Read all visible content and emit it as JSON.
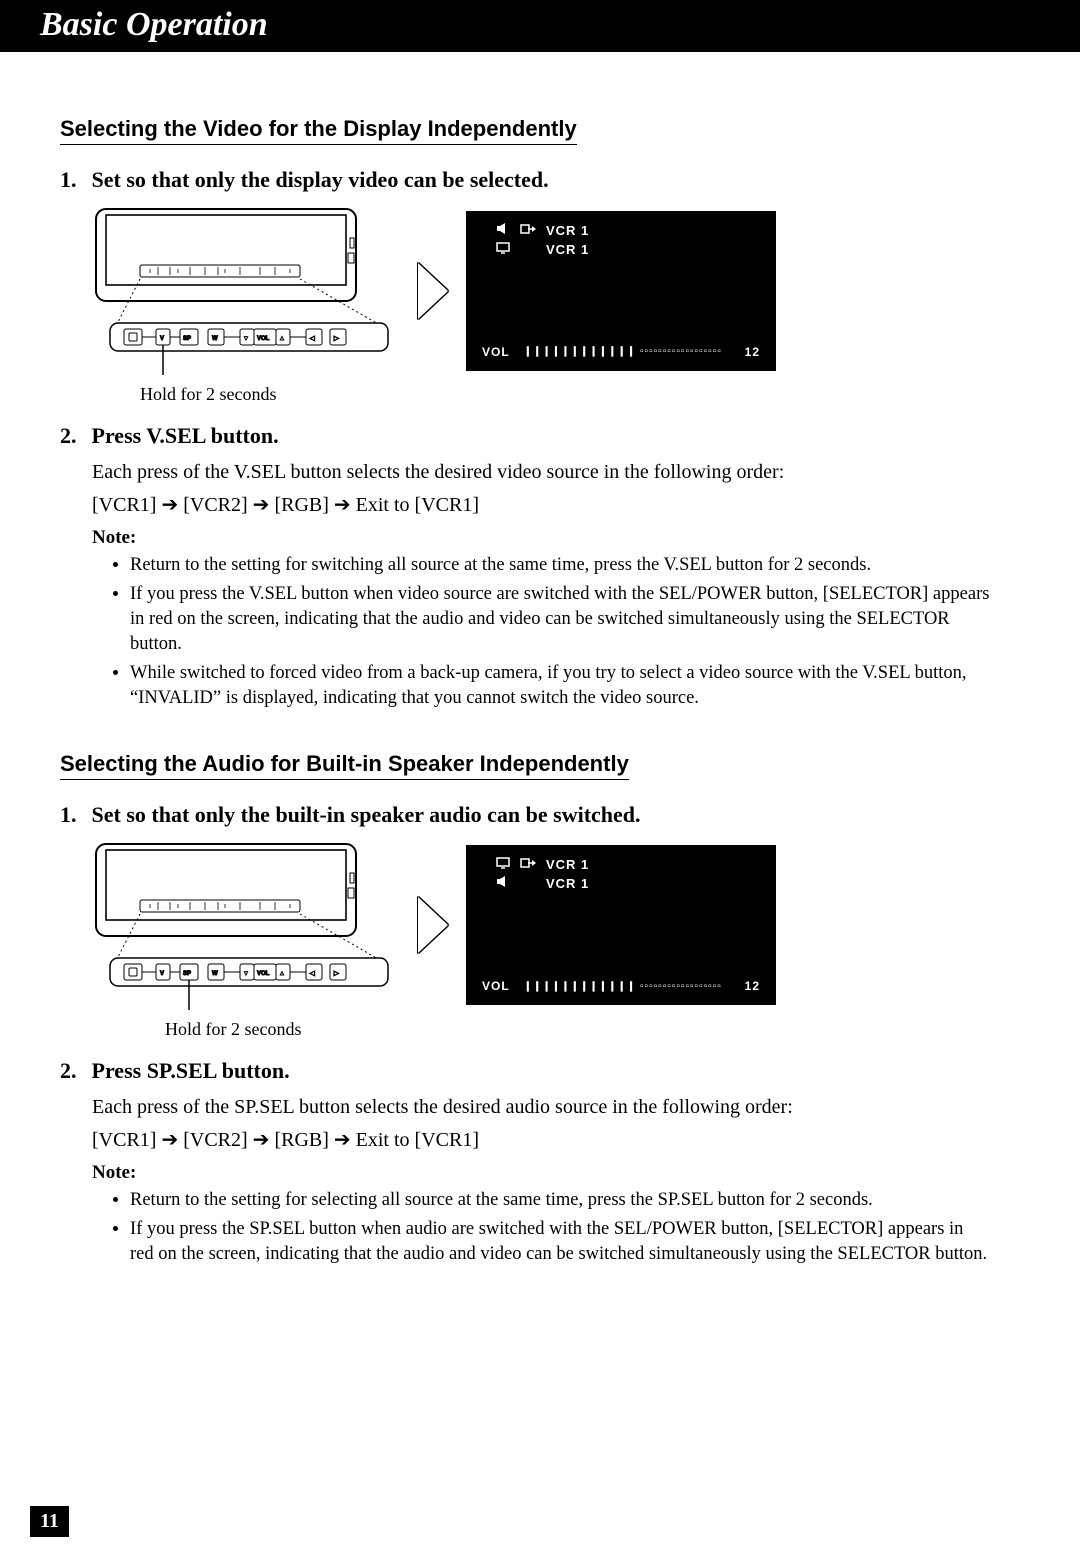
{
  "header": {
    "title": "Basic Operation"
  },
  "page_number": "11",
  "section1": {
    "heading": "Selecting the Video for the Display Independently",
    "step1": {
      "num": "1.",
      "text": "Set so that only the display video can be selected."
    },
    "caption": "Hold for 2 seconds",
    "osd": {
      "line1_label": "VCR 1",
      "line2_label": "VCR 1",
      "vol_label": "VOL",
      "vol_value": "12"
    },
    "step2": {
      "num": "2.",
      "text": "Press V.SEL button.",
      "desc": "Each press of the V.SEL button selects the desired video source in the following order:",
      "seq": {
        "a": "[VCR1]",
        "b": "[VCR2]",
        "c": "[RGB]",
        "d": "Exit to [VCR1]"
      }
    },
    "note_label": "Note:",
    "notes": [
      "Return to the setting for switching all source at the same time, press the V.SEL button for 2 seconds.",
      "If you press the V.SEL button when video source are switched with the SEL/POWER button, [SELECTOR] appears in red on the screen, indicating that the audio and video can be switched simultaneously using the SELECTOR button.",
      "While switched to forced video from a back-up camera, if you try to select a video source with the V.SEL button, “INVALID” is displayed, indicating that you cannot switch the video source."
    ]
  },
  "section2": {
    "heading": "Selecting the Audio for Built-in Speaker Independently",
    "step1": {
      "num": "1.",
      "text": "Set so that only the built-in speaker audio can be switched."
    },
    "caption": "Hold for 2 seconds",
    "osd": {
      "line1_label": "VCR 1",
      "line2_label": "VCR 1",
      "vol_label": "VOL",
      "vol_value": "12"
    },
    "step2": {
      "num": "2.",
      "text": "Press SP.SEL button.",
      "desc": "Each press of the SP.SEL button selects the desired audio source in the following order:",
      "seq": {
        "a": "[VCR1]",
        "b": "[VCR2]",
        "c": "[RGB]",
        "d": "Exit to [VCR1]"
      }
    },
    "note_label": "Note:",
    "notes": [
      "Return to the setting for selecting all source at the same time, press the SP.SEL button for 2 sec­onds.",
      "If you press the SP.SEL button when audio are switched with the SEL/POWER button, [SELEC­TOR] appears in red on the screen, indicating that the audio and video can be switched simultane­ously using the SELECTOR button."
    ]
  },
  "device_buttons": {
    "power": "⏻",
    "v": "V",
    "sp": "SP",
    "w": "W",
    "vol_down": "▼",
    "vol_label": "VOL",
    "vol_up": "▲",
    "left": "◀",
    "right": "▶"
  }
}
